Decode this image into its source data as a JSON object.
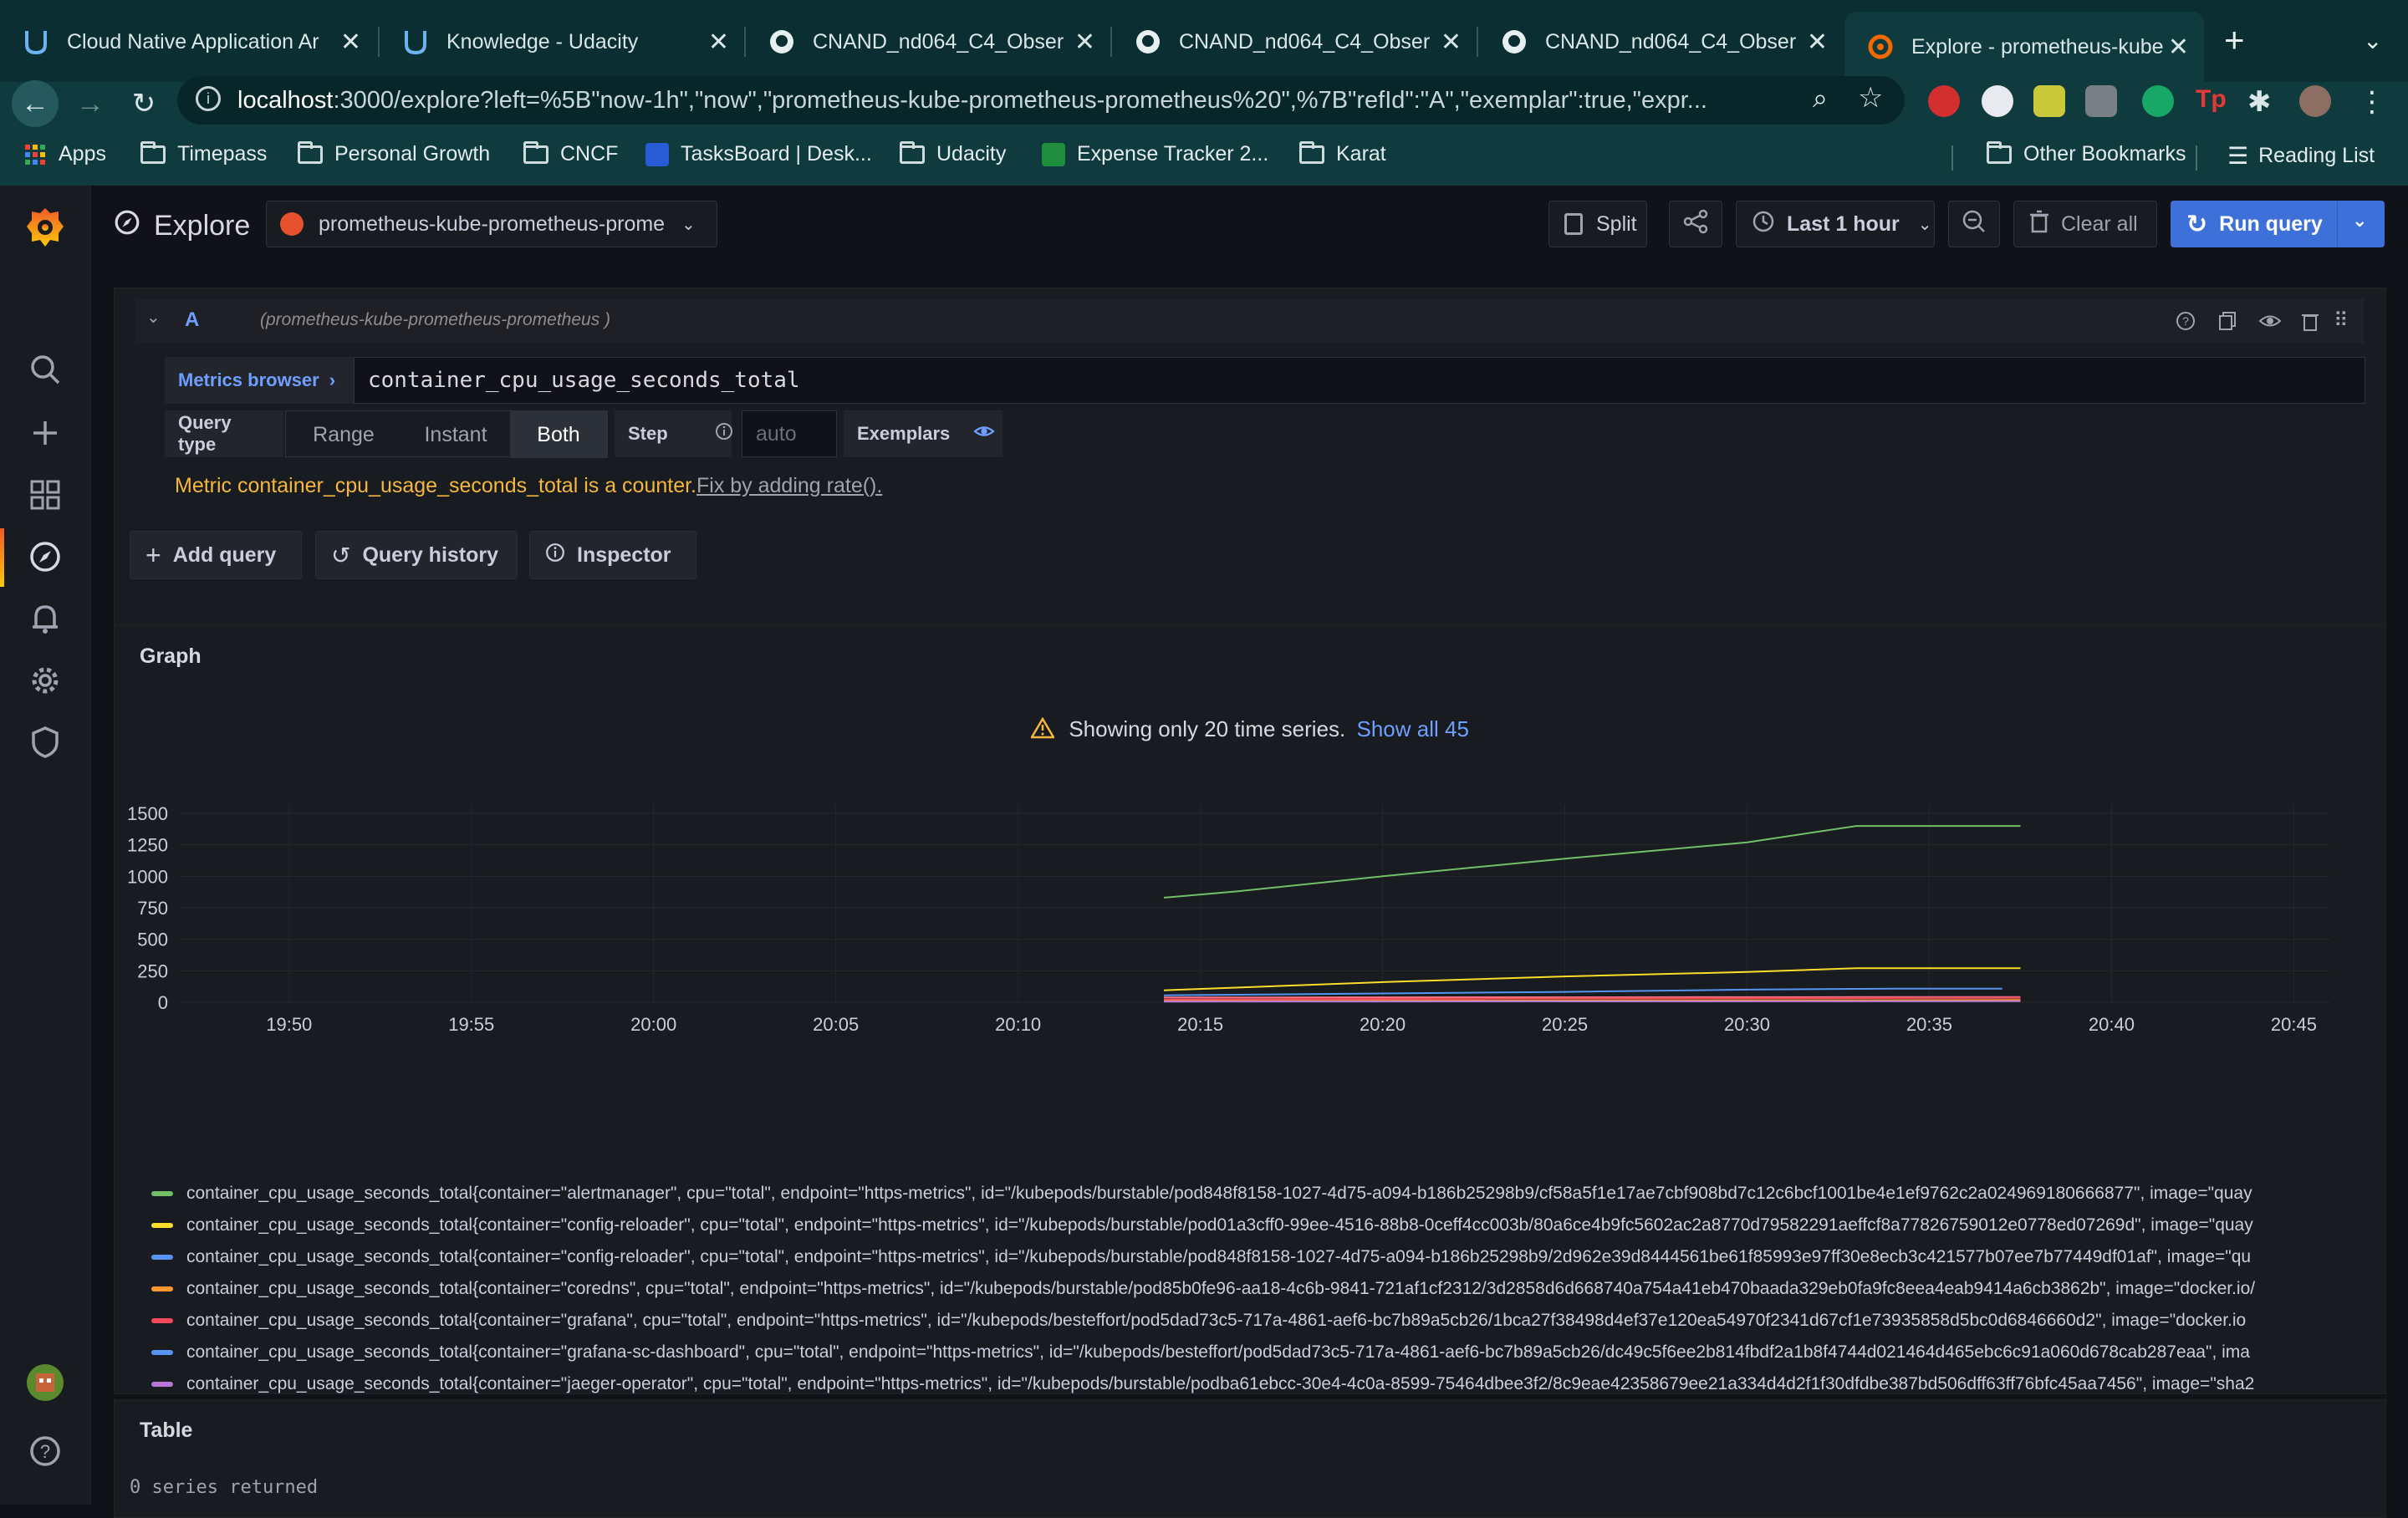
{
  "browser": {
    "tabs": [
      {
        "label": "Cloud Native Application Ar",
        "icon": "udacity-icon"
      },
      {
        "label": "Knowledge - Udacity",
        "icon": "udacity-icon"
      },
      {
        "label": "CNAND_nd064_C4_Obser",
        "icon": "github-icon"
      },
      {
        "label": "CNAND_nd064_C4_Obser",
        "icon": "github-icon"
      },
      {
        "label": "CNAND_nd064_C4_Obser",
        "icon": "github-icon"
      },
      {
        "label": "Explore - prometheus-kube",
        "icon": "grafana-icon"
      }
    ],
    "url_host": "localhost",
    "url_rest": ":3000/explore?left=%5B\"now-1h\",\"now\",\"prometheus-kube-prometheus-prometheus%20\",%7B\"refId\":\"A\",\"exemplar\":true,\"expr...",
    "bookmarks": [
      "Apps",
      "Timepass",
      "Personal Growth",
      "CNCF",
      "TasksBoard | Desk...",
      "Udacity",
      "Expense Tracker 2...",
      "Karat"
    ],
    "bookmarks_right": [
      "Other Bookmarks",
      "Reading List"
    ]
  },
  "toolbar": {
    "title": "Explore",
    "datasource": "prometheus-kube-prometheus-prome",
    "split": "Split",
    "time_range": "Last 1 hour",
    "clear_all": "Clear all",
    "run_query": "Run query"
  },
  "query": {
    "ref_id": "A",
    "datasource_hint": "(prometheus-kube-prometheus-prometheus )",
    "metrics_browser": "Metrics browser",
    "expr": "container_cpu_usage_seconds_total",
    "query_type_label": "Query type",
    "query_types": [
      "Range",
      "Instant",
      "Both"
    ],
    "active_query_type": "Both",
    "step_label": "Step",
    "step_placeholder": "auto",
    "exemplars_label": "Exemplars",
    "warning": "Metric container_cpu_usage_seconds_total is a counter.",
    "fix_link": "Fix by adding rate().",
    "add_query": "Add query",
    "query_history": "Query history",
    "inspector": "Inspector"
  },
  "graph": {
    "title": "Graph",
    "notice": "Showing only 20 time series.",
    "show_all": "Show all 45"
  },
  "chart_data": {
    "type": "line",
    "title": "",
    "xlabel": "",
    "ylabel": "",
    "xticks": [
      "19:50",
      "19:55",
      "20:00",
      "20:05",
      "20:10",
      "20:15",
      "20:20",
      "20:25",
      "20:30",
      "20:35",
      "20:40",
      "20:45"
    ],
    "yticks": [
      0,
      250,
      500,
      750,
      1000,
      1250,
      1500
    ],
    "ylim": [
      0,
      1500
    ],
    "x_range_minutes": [
      "19:47",
      "20:46"
    ],
    "series": [
      {
        "color": "#73bf69",
        "points": [
          [
            "20:14",
            830
          ],
          [
            "20:16",
            880
          ],
          [
            "20:20",
            1000
          ],
          [
            "20:25",
            1140
          ],
          [
            "20:30",
            1270
          ],
          [
            "20:33",
            1400
          ],
          [
            "20:37.5",
            1400
          ]
        ]
      },
      {
        "color": "#fade2a",
        "points": [
          [
            "20:14",
            95
          ],
          [
            "20:20",
            160
          ],
          [
            "20:25",
            205
          ],
          [
            "20:30",
            240
          ],
          [
            "20:33",
            270
          ],
          [
            "20:37.5",
            270
          ]
        ]
      },
      {
        "color": "#5794f2",
        "points": [
          [
            "20:14",
            55
          ],
          [
            "20:20",
            70
          ],
          [
            "20:25",
            82
          ],
          [
            "20:30",
            100
          ],
          [
            "20:34",
            108
          ],
          [
            "20:37",
            108
          ]
        ]
      },
      {
        "color": "#ff7383",
        "points": [
          [
            "20:14",
            38
          ],
          [
            "20:25",
            40
          ],
          [
            "20:37.5",
            42
          ]
        ]
      },
      {
        "color": "#f2495c",
        "points": [
          [
            "20:14",
            22
          ],
          [
            "20:25",
            30
          ],
          [
            "20:37.5",
            35
          ]
        ]
      },
      {
        "color": "#ff9830",
        "points": [
          [
            "20:14",
            10
          ],
          [
            "20:25",
            14
          ],
          [
            "20:37.5",
            18
          ]
        ]
      },
      {
        "color": "#b877d9",
        "points": [
          [
            "20:14",
            5
          ],
          [
            "20:37.5",
            8
          ]
        ]
      }
    ]
  },
  "legend": [
    {
      "color": "#73bf69",
      "text": "container_cpu_usage_seconds_total{container=\"alertmanager\", cpu=\"total\", endpoint=\"https-metrics\", id=\"/kubepods/burstable/pod848f8158-1027-4d75-a094-b186b25298b9/cf58a5f1e17ae7cbf908bd7c12c6bcf1001be4e1ef9762c2a024969180666877\", image=\"quay"
    },
    {
      "color": "#fade2a",
      "text": "container_cpu_usage_seconds_total{container=\"config-reloader\", cpu=\"total\", endpoint=\"https-metrics\", id=\"/kubepods/burstable/pod01a3cff0-99ee-4516-88b8-0ceff4cc003b/80a6ce4b9fc5602ac2a8770d79582291aeffcf8a77826759012e0778ed07269d\", image=\"quay"
    },
    {
      "color": "#5794f2",
      "text": "container_cpu_usage_seconds_total{container=\"config-reloader\", cpu=\"total\", endpoint=\"https-metrics\", id=\"/kubepods/burstable/pod848f8158-1027-4d75-a094-b186b25298b9/2d962e39d8444561be61f85993e97ff30e8ecb3c421577b07ee7b77449df01af\", image=\"qu"
    },
    {
      "color": "#ff9830",
      "text": "container_cpu_usage_seconds_total{container=\"coredns\", cpu=\"total\", endpoint=\"https-metrics\", id=\"/kubepods/burstable/pod85b0fe96-aa18-4c6b-9841-721af1cf2312/3d2858d6d668740a754a41eb470baada329eb0fa9fc8eea4eab9414a6cb3862b\", image=\"docker.io/"
    },
    {
      "color": "#f2495c",
      "text": "container_cpu_usage_seconds_total{container=\"grafana\", cpu=\"total\", endpoint=\"https-metrics\", id=\"/kubepods/besteffort/pod5dad73c5-717a-4861-aef6-bc7b89a5cb26/1bca27f38498d4ef37e120ea54970f2341d67cf1e73935858d5bc0d6846660d2\", image=\"docker.io"
    },
    {
      "color": "#5794f2",
      "text": "container_cpu_usage_seconds_total{container=\"grafana-sc-dashboard\", cpu=\"total\", endpoint=\"https-metrics\", id=\"/kubepods/besteffort/pod5dad73c5-717a-4861-aef6-bc7b89a5cb26/dc49c5f6ee2b814fbdf2a1b8f4744d021464d465ebc6c91a060d678cab287eaa\", ima"
    },
    {
      "color": "#b877d9",
      "text": "container_cpu_usage_seconds_total{container=\"jaeger-operator\", cpu=\"total\", endpoint=\"https-metrics\", id=\"/kubepods/burstable/podba61ebcc-30e4-4c0a-8599-75464dbee3f2/8c9eae42358679ee21a334d4d2f1f30dfdbe387bd506dff63ff76bfc45aa7456\", image=\"sha2"
    }
  ],
  "table": {
    "title": "Table",
    "empty": "0 series returned"
  }
}
